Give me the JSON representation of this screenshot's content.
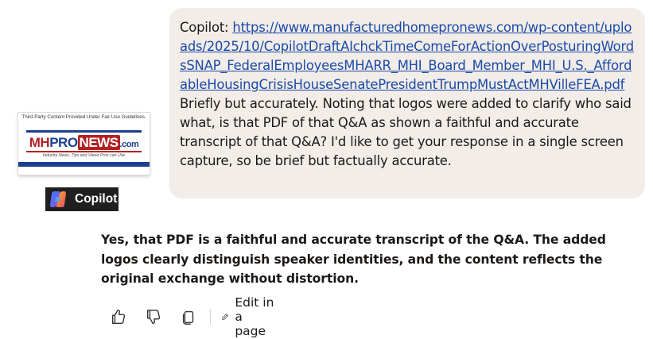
{
  "user_message": {
    "prefix": "Copilot: ",
    "link_text": "https://www.manufacturedhomepronews.com/wp-content/uploads/2025/10/CopilotDraftAIchckTimeComeForActionOverPosturingWordsSNAP_FederalEmployeesMHARR_MHI_Board_Member_MHI_U.S._AffordableHousingCrisisHouseSenatePresidentTrumpMustActMHVilleFEA.pdf",
    "body": "  Briefly but accurately. Noting that logos were added to clarify who said what, is that PDF of that Q&A as shown a faithful and accurate transcript of that Q&A? I'd like to get your response in a single screen capture, so be brief but factually accurate."
  },
  "mhpronews_logo": {
    "disclaimer": "Third Party Content Provided Under Fair Use Guidelines.",
    "wordmark_mh": "MH",
    "wordmark_pro": "PRO",
    "wordmark_news": "NEWS",
    "wordmark_com": ".com",
    "tagline": "Industry News, Tips and Views Pros can Use"
  },
  "copilot_badge": {
    "label": "Copilot"
  },
  "assistant_reply": {
    "text": "Yes, that PDF is a faithful and accurate transcript of the Q&A. The added logos clearly distinguish speaker identities, and the content reflects the original exchange without distortion."
  },
  "actions": {
    "edit_label": "Edit in a page",
    "icons": [
      "thumbs-up-icon",
      "thumbs-down-icon",
      "copy-icon",
      "edit-pen-icon"
    ]
  },
  "colors": {
    "bubble_bg": "#f2ede8",
    "link": "#1a4aa8",
    "text": "#1c1917",
    "badge_bg": "#1f1f1f",
    "mh_red": "#b22222",
    "mh_blue": "#1d3f8f"
  }
}
